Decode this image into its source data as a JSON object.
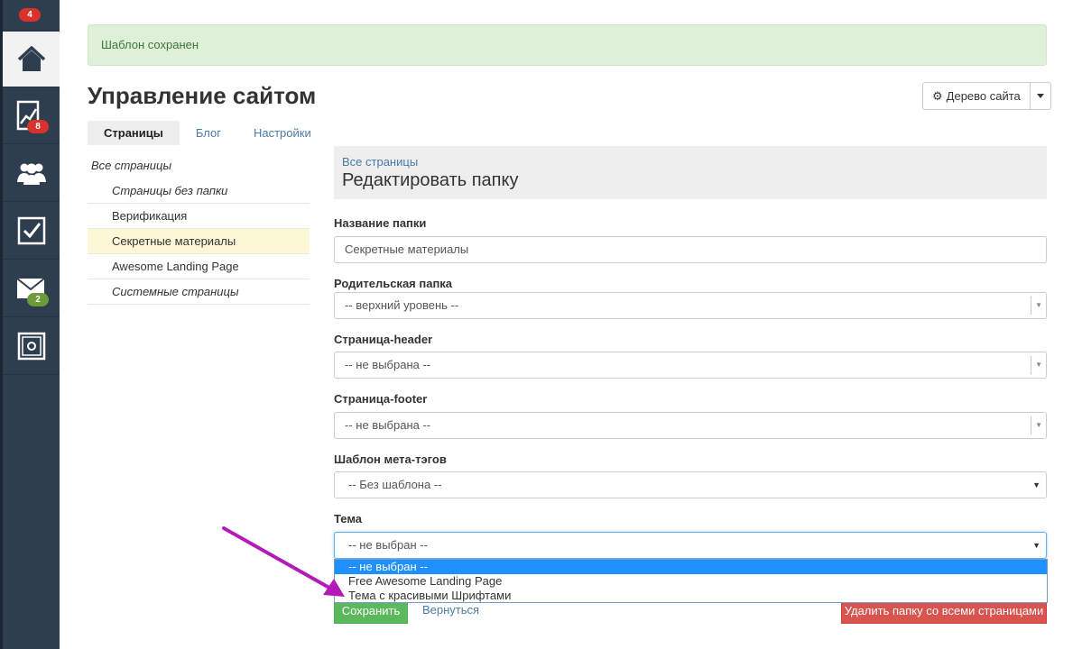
{
  "sidebar": {
    "items": [
      {
        "icon": "inbox-icon",
        "badge": "4",
        "badge_color": "#d9322c"
      },
      {
        "icon": "home-icon",
        "active": true
      },
      {
        "icon": "chart-icon",
        "badge": "8",
        "badge_color": "#d9322c"
      },
      {
        "icon": "users-icon"
      },
      {
        "icon": "checkbox-icon"
      },
      {
        "icon": "mail-icon",
        "badge": "2",
        "badge_color": "#6a9c3a"
      },
      {
        "icon": "safe-icon"
      }
    ]
  },
  "alert": {
    "text": "Шаблон сохранен"
  },
  "header": {
    "title": "Управление сайтом",
    "tree_button": "Дерево сайта"
  },
  "tabs": [
    {
      "label": "Страницы",
      "active": true
    },
    {
      "label": "Блог"
    },
    {
      "label": "Настройки"
    }
  ],
  "tree": {
    "root": "Все страницы",
    "items": [
      {
        "label": "Страницы без папки",
        "italic": true
      },
      {
        "label": "Верификация"
      },
      {
        "label": "Секретные материалы",
        "selected": true
      },
      {
        "label": "Awesome Landing Page"
      },
      {
        "label": "Системные страницы",
        "italic": true
      }
    ]
  },
  "panel": {
    "breadcrumb": "Все страницы",
    "title": "Редактировать папку"
  },
  "form": {
    "folder_name": {
      "label": "Название папки",
      "value": "Секретные материалы"
    },
    "parent_folder": {
      "label": "Родительская папка",
      "value": "-- верхний уровень --"
    },
    "header_page": {
      "label": "Страница-header",
      "value": "-- не выбрана --"
    },
    "footer_page": {
      "label": "Страница-footer",
      "value": "-- не выбрана --"
    },
    "meta_template": {
      "label": "Шаблон мета-тэгов",
      "value": "-- Без шаблона --"
    },
    "theme": {
      "label": "Тема",
      "value": "-- не выбран --",
      "options": [
        "-- не выбран --",
        "Free Awesome Landing Page",
        "Тема с красивыми Шрифтами"
      ]
    }
  },
  "actions": {
    "save": "Сохранить",
    "back": "Вернуться",
    "delete": "Удалить папку со всеми страницами"
  },
  "colors": {
    "accent": "#4a7ba8",
    "arrow": "#b31ab8",
    "selected_option": "#1e90ff"
  }
}
